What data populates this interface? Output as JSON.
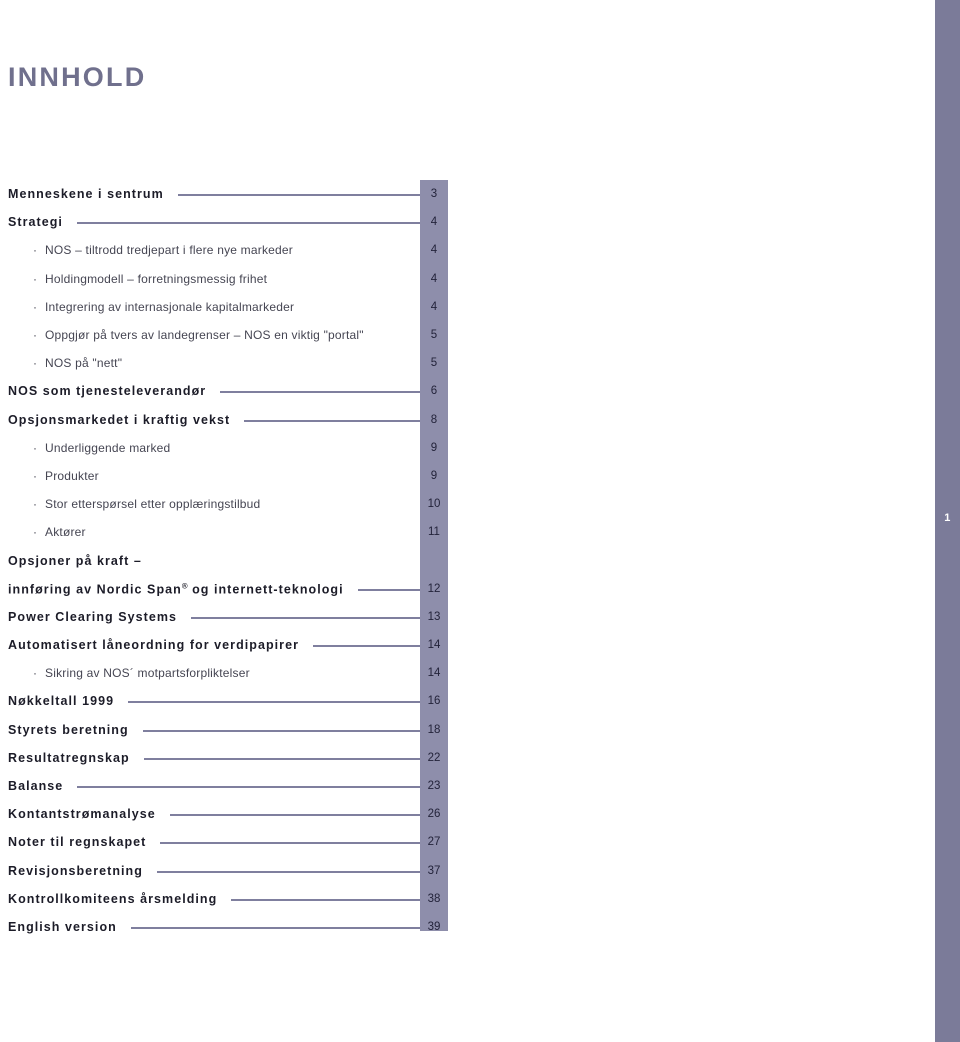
{
  "page": {
    "title": "INNHOLD",
    "folio": "1",
    "accent_band_color": "#8e8eab",
    "edge_bar_color": "#7b7b99",
    "title_color": "#70708d",
    "leader_color": "#7f7f9e"
  },
  "toc": {
    "bullet_glyph": "·",
    "entries": [
      {
        "label": "Menneskene i sentrum",
        "page": "3",
        "level": "head",
        "leader": true
      },
      {
        "label": "Strategi",
        "page": "4",
        "level": "head",
        "leader": true
      },
      {
        "label": "NOS – tiltrodd tredjepart i flere nye markeder",
        "page": "4",
        "level": "sub",
        "leader": false
      },
      {
        "label": "Holdingmodell – forretningsmessig frihet",
        "page": "4",
        "level": "sub",
        "leader": false
      },
      {
        "label": "Integrering av internasjonale kapitalmarkeder",
        "page": "4",
        "level": "sub",
        "leader": false
      },
      {
        "label": "Oppgjør på tvers av landegrenser – NOS en viktig \"portal\"",
        "page": "5",
        "level": "sub",
        "leader": false
      },
      {
        "label": "NOS på \"nett\"",
        "page": "5",
        "level": "sub",
        "leader": false
      },
      {
        "label": "NOS som tjenesteleverandør",
        "page": "6",
        "level": "head",
        "leader": true
      },
      {
        "label": "Opsjonsmarkedet i kraftig vekst",
        "page": "8",
        "level": "head",
        "leader": true
      },
      {
        "label": "Underliggende marked",
        "page": "9",
        "level": "sub",
        "leader": false
      },
      {
        "label": "Produkter",
        "page": "9",
        "level": "sub",
        "leader": false
      },
      {
        "label": "Stor etterspørsel etter opplæringstilbud",
        "page": "10",
        "level": "sub",
        "leader": false
      },
      {
        "label": "Aktører",
        "page": "11",
        "level": "sub",
        "leader": false
      },
      {
        "label": "Opsjoner på kraft –",
        "page": "",
        "level": "head",
        "leader": false
      },
      {
        "label": "innføring av Nordic Span® og internett-teknologi",
        "page": "12",
        "level": "head",
        "leader": true,
        "html": "innføring av Nordic Span<sup class=\"reg\">®</sup> og internett-teknologi"
      },
      {
        "label": "Power Clearing Systems",
        "page": "13",
        "level": "head",
        "leader": true
      },
      {
        "label": "Automatisert låneordning for verdipapirer",
        "page": "14",
        "level": "head",
        "leader": true
      },
      {
        "label": "Sikring av NOS´ motpartsforpliktelser",
        "page": "14",
        "level": "sub",
        "leader": false
      },
      {
        "label": "Nøkkeltall 1999",
        "page": "16",
        "level": "head",
        "leader": true
      },
      {
        "label": "Styrets beretning",
        "page": "18",
        "level": "head",
        "leader": true
      },
      {
        "label": "Resultatregnskap",
        "page": "22",
        "level": "head",
        "leader": true
      },
      {
        "label": "Balanse",
        "page": "23",
        "level": "head",
        "leader": true
      },
      {
        "label": "Kontantstrømanalyse",
        "page": "26",
        "level": "head",
        "leader": true
      },
      {
        "label": "Noter til regnskapet",
        "page": "27",
        "level": "head",
        "leader": true
      },
      {
        "label": "Revisjonsberetning",
        "page": "37",
        "level": "head",
        "leader": true
      },
      {
        "label": "Kontrollkomiteens årsmelding",
        "page": "38",
        "level": "head",
        "leader": true
      },
      {
        "label": "English version",
        "page": "39",
        "level": "head",
        "leader": true
      }
    ]
  }
}
